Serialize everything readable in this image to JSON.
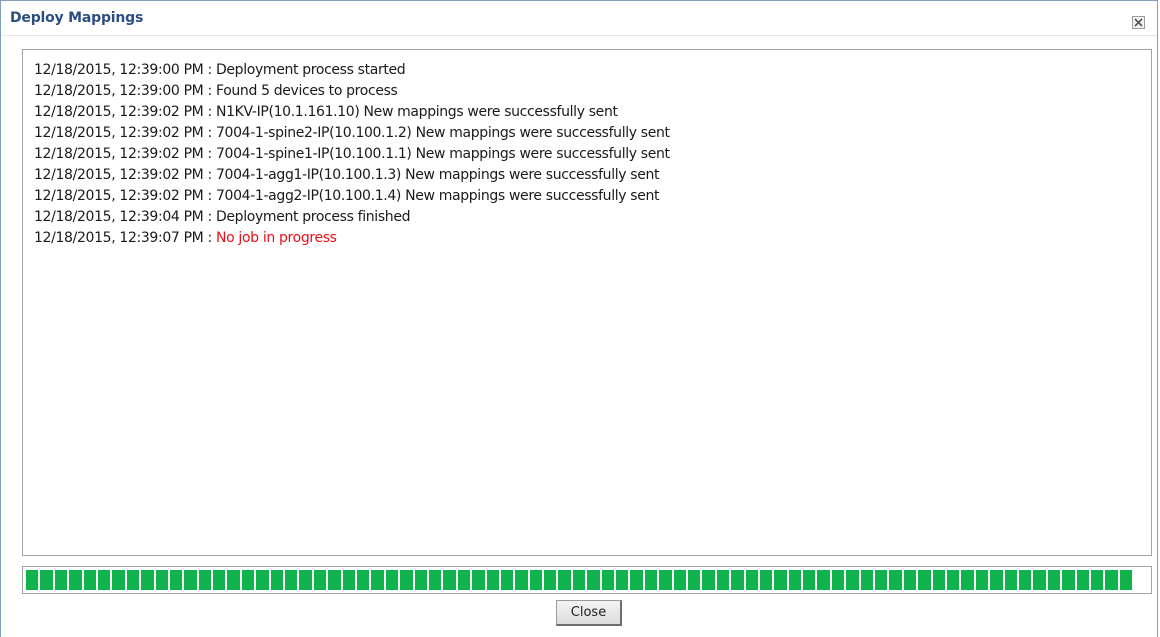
{
  "dialog": {
    "title": "Deploy Mappings",
    "close_icon": "close-x-icon"
  },
  "log": [
    {
      "timestamp": "12/18/2015, 12:39:00 PM",
      "separator": " : ",
      "message": "Deployment process started",
      "status": "normal"
    },
    {
      "timestamp": "12/18/2015, 12:39:00 PM",
      "separator": " : ",
      "message": "Found 5 devices to process",
      "status": "normal"
    },
    {
      "timestamp": "12/18/2015, 12:39:02 PM",
      "separator": " : ",
      "message": "N1KV-IP(10.1.161.10) New mappings were successfully sent",
      "status": "normal"
    },
    {
      "timestamp": "12/18/2015, 12:39:02 PM",
      "separator": " : ",
      "message": "7004-1-spine2-IP(10.100.1.2) New mappings were successfully sent",
      "status": "normal"
    },
    {
      "timestamp": "12/18/2015, 12:39:02 PM",
      "separator": " : ",
      "message": "7004-1-spine1-IP(10.100.1.1) New mappings were successfully sent",
      "status": "normal"
    },
    {
      "timestamp": "12/18/2015, 12:39:02 PM",
      "separator": " : ",
      "message": "7004-1-agg1-IP(10.100.1.3) New mappings were successfully sent",
      "status": "normal"
    },
    {
      "timestamp": "12/18/2015, 12:39:02 PM",
      "separator": " : ",
      "message": "7004-1-agg2-IP(10.100.1.4) New mappings were successfully sent",
      "status": "normal"
    },
    {
      "timestamp": "12/18/2015, 12:39:04 PM",
      "separator": " : ",
      "message": "Deployment process finished",
      "status": "normal"
    },
    {
      "timestamp": "12/18/2015, 12:39:07 PM",
      "separator": " : ",
      "message": "No job in progress",
      "status": "error"
    }
  ],
  "progress": {
    "value": 1.0,
    "segment_count": 77,
    "color": "#0fb24b"
  },
  "buttons": {
    "close_label": "Close"
  },
  "colors": {
    "title": "#2c4f83",
    "error_text": "#e8101a",
    "text": "#1a1a1a"
  }
}
